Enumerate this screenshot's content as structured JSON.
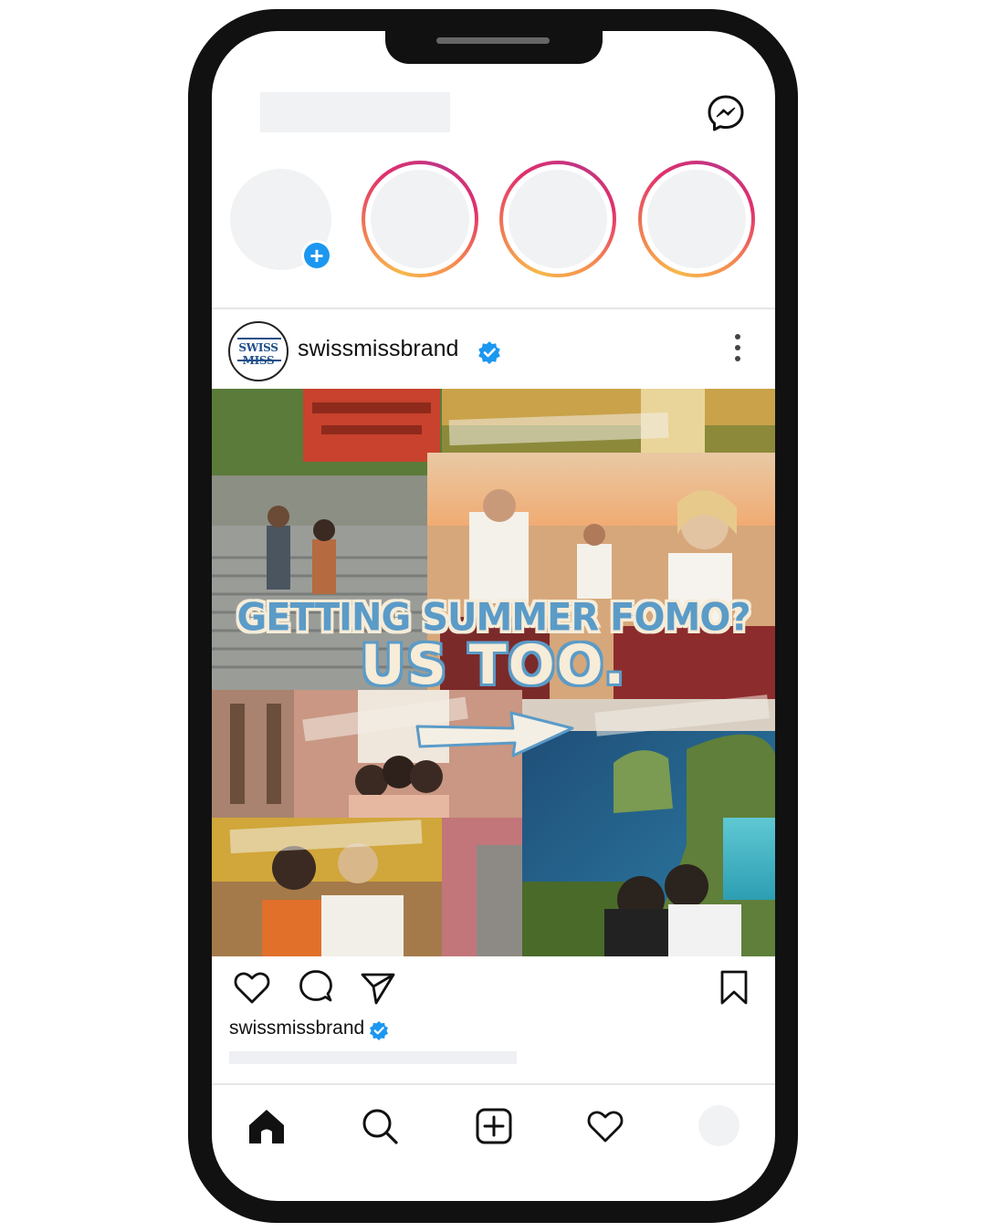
{
  "post": {
    "username": "swissmissbrand",
    "avatar_text": "SWISS MISS",
    "image_headline": "GETTING SUMMER FOMO?",
    "image_subheadline": "US TOO."
  },
  "caption": {
    "username": "swissmissbrand"
  },
  "colors": {
    "verified": "#1c97f0",
    "headline_blue": "#5b9bc7",
    "headline_cream": "#f6ecd8",
    "story_ring_start": "#f7b84c",
    "story_ring_end": "#e1306c"
  },
  "icons": {
    "header": [
      "messenger-icon"
    ],
    "post_header": [
      "verified-badge-icon",
      "more-options-icon"
    ],
    "actions": [
      "heart-icon",
      "comment-icon",
      "share-icon",
      "bookmark-icon"
    ],
    "bottom_nav": [
      "home-icon",
      "search-icon",
      "add-post-icon",
      "activity-heart-icon",
      "profile-avatar"
    ]
  }
}
